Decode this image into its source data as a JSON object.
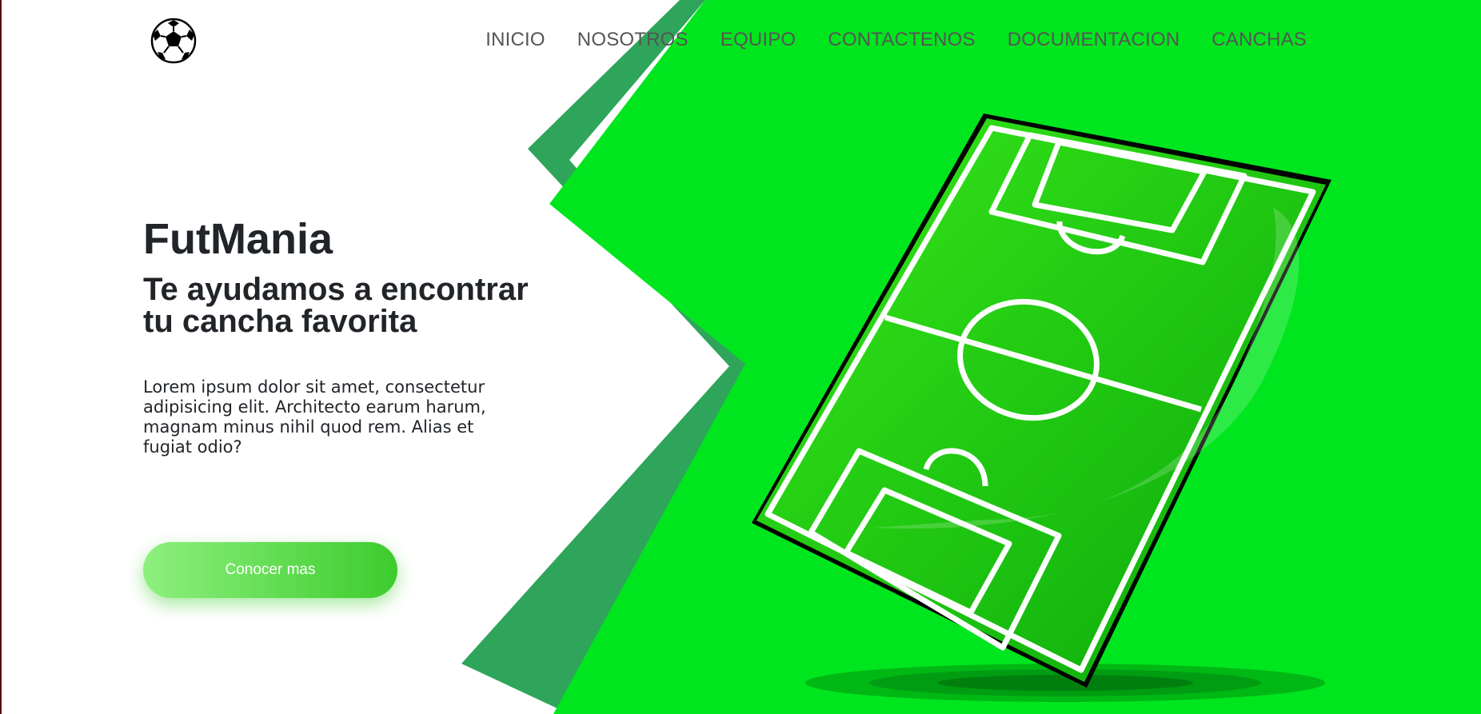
{
  "brand": {
    "logo_icon": "soccer-ball-icon"
  },
  "nav": {
    "items": [
      {
        "label": "INICIO"
      },
      {
        "label": "NOSOTROS"
      },
      {
        "label": "EQUIPO"
      },
      {
        "label": "CONTACTENOS"
      },
      {
        "label": "DOCUMENTACION"
      },
      {
        "label": "CANCHAS"
      }
    ]
  },
  "hero": {
    "title": "FutMania",
    "subtitle": "Te ayudamos a encontrar tu cancha favorita",
    "description": "Lorem ipsum dolor sit amet, consectetur adipisicing elit. Architecto earum harum, magnam minus nihil quod rem. Alias et fugiat odio?",
    "cta_label": "Conocer mas",
    "illustration_icon": "soccer-field-illustration"
  },
  "colors": {
    "accent_green": "#00e61e",
    "dark_green": "#2ea55a",
    "text_dark": "#212529",
    "nav_text": "#555555",
    "button_gradient_start": "#8ef07f",
    "button_gradient_end": "#3ccc2c"
  }
}
